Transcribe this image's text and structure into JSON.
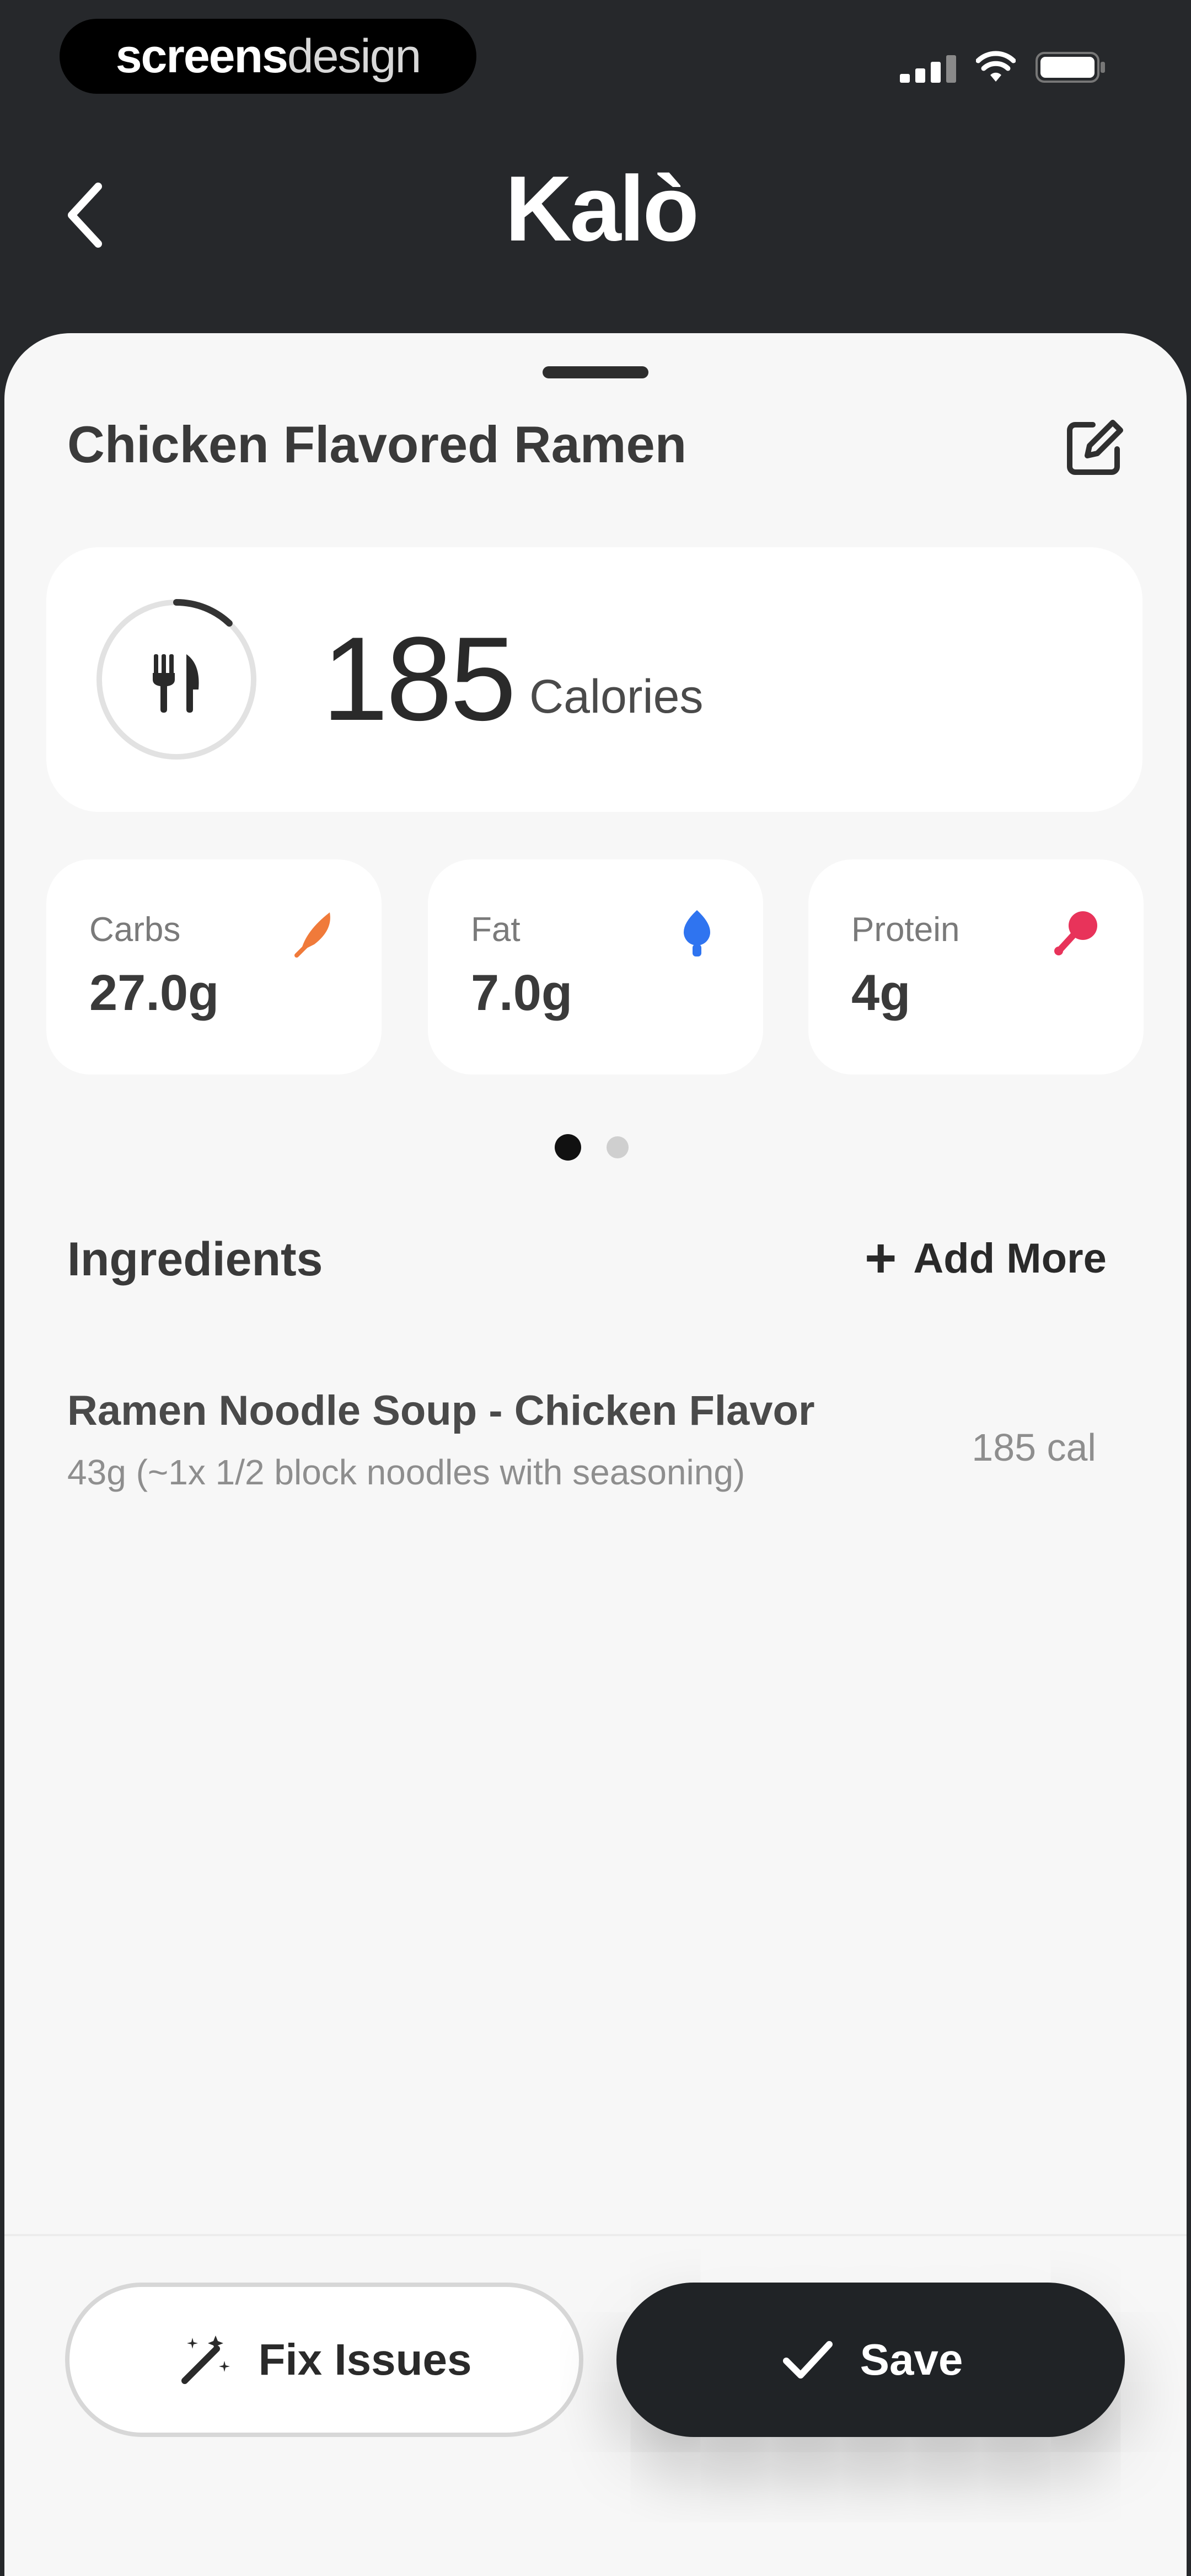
{
  "status_bar": {
    "brand_bold": "screens",
    "brand_light": "design"
  },
  "header": {
    "title": "Kalò",
    "back_icon": "chevron-left-icon"
  },
  "meal": {
    "title": "Chicken Flavored Ramen",
    "edit_icon": "edit-square-pencil-icon",
    "calories_value": "185",
    "calories_unit": "Calories",
    "calorie_ring_progress": 0.12
  },
  "macros": [
    {
      "label": "Carbs",
      "value": "27.0g",
      "icon": "wheat-icon",
      "color": "#f07a3a"
    },
    {
      "label": "Fat",
      "value": "7.0g",
      "icon": "drop-icon",
      "color": "#2f74f0"
    },
    {
      "label": "Protein",
      "value": "4g",
      "icon": "drumstick-icon",
      "color": "#e8335a"
    }
  ],
  "pager": {
    "count": 2,
    "active": 0
  },
  "ingredients": {
    "title": "Ingredients",
    "add_more_label": "Add More",
    "items": [
      {
        "name": "Ramen Noodle Soup - Chicken Flavor",
        "serving": "43g (~1x 1/2 block noodles with seasoning)",
        "calories": "185 cal"
      }
    ]
  },
  "actions": {
    "fix_label": "Fix Issues",
    "save_label": "Save"
  },
  "colors": {
    "header_bg": "#26282b",
    "sheet_bg": "#f7f7f7",
    "primary_button": "#202326"
  }
}
